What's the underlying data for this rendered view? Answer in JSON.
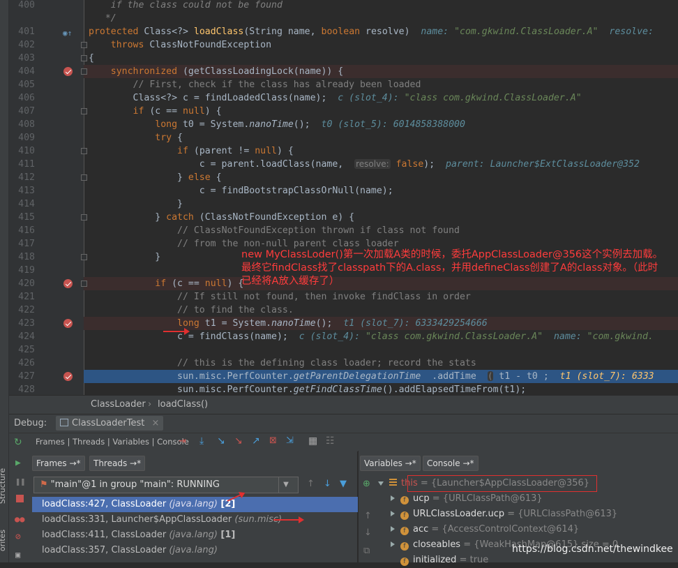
{
  "editor": {
    "lines": [
      {
        "n": "400",
        "html": "<span class='cm it'>    if the class could not be found</span>"
      },
      {
        "n": "",
        "html": "<span class='cm it'>   */</span>"
      },
      {
        "n": "401",
        "html": "<span class='kw'>protected</span> Class&lt;?&gt; <span class='fn'>loadClass</span>(String name, <span class='kw'>boolean</span> resolve)  <span class='hint'>name: <span class='hintv'>\"com.gkwind.ClassLoader.A\"</span>  resolve:</span>"
      },
      {
        "n": "402",
        "html": "    <span class='kw'>throws</span> ClassNotFoundException"
      },
      {
        "n": "403",
        "html": "{"
      },
      {
        "n": "404",
        "html": "    <span class='kw'>synchronized</span> (getClassLoadingLock(name)) {"
      },
      {
        "n": "405",
        "html": "        <span class='cm'>// First, check if the class has already been loaded</span>"
      },
      {
        "n": "406",
        "html": "        Class&lt;?&gt; c = findLoadedClass(name);  <span class='hint'>c (slot_4): <span class='hintv'>\"class com.gkwind.ClassLoader.A\"</span></span>"
      },
      {
        "n": "407",
        "html": "        <span class='kw'>if</span> (c == <span class='kw'>null</span>) {"
      },
      {
        "n": "408",
        "html": "            <span class='kw'>long</span> t0 = System.<span class='it'>nanoTime</span>();  <span class='hint'>t0 (slot_5): 6014858388000</span>"
      },
      {
        "n": "409",
        "html": "            <span class='kw'>try</span> {"
      },
      {
        "n": "410",
        "html": "                <span class='kw'>if</span> (parent != <span class='kw'>null</span>) {"
      },
      {
        "n": "411",
        "html": "                    c = parent.loadClass(name,  <span class='pn'>resolve:</span> <span class='kw'>false</span>);  <span class='hint'>parent: Launcher$ExtClassLoader@352</span>"
      },
      {
        "n": "412",
        "html": "                } <span class='kw'>else</span> {"
      },
      {
        "n": "413",
        "html": "                    c = findBootstrapClassOrNull(name);"
      },
      {
        "n": "414",
        "html": "                }"
      },
      {
        "n": "415",
        "html": "            } <span class='kw'>catch</span> (ClassNotFoundException e) {"
      },
      {
        "n": "416",
        "html": "                <span class='cm'>// ClassNotFoundException thrown if class not found</span>"
      },
      {
        "n": "417",
        "html": "                <span class='cm'>// from the non-null parent class loader</span>"
      },
      {
        "n": "418",
        "html": "            }"
      },
      {
        "n": "419",
        "html": ""
      },
      {
        "n": "420",
        "html": "            <span class='kw'>if</span> (c == <span class='kw'>null</span>) {"
      },
      {
        "n": "421",
        "html": "                <span class='cm'>// If still not found, then invoke findClass in order</span>"
      },
      {
        "n": "422",
        "html": "                <span class='cm'>// to find the class.</span>"
      },
      {
        "n": "423",
        "html": "                <span class='kw'>long</span> t1 = System.<span class='it'>nanoTime</span>();  <span class='hint'>t1 (slot_7): 6333429254666</span>"
      },
      {
        "n": "424",
        "html": "                c = findClass(name);  <span class='hint'>c (slot_4): <span class='hintv'>\"class com.gkwind.ClassLoader.A\"</span>  name: <span class='hintv'>\"com.gkwind.</span></span>"
      },
      {
        "n": "425",
        "html": ""
      },
      {
        "n": "426",
        "html": "                <span class='cm'>// this is the defining class loader; record the stats</span>"
      },
      {
        "n": "427",
        "html": "                sun.misc.PerfCounter.<span class='it'>getParentDelegationTime</span>  .addTime  <span class='pn'>(</span> t1 - t0 ;  <span class='it' style='color:#ffc66d'>t1 (slot_7): 6333</span>"
      },
      {
        "n": "428",
        "html": "                sun.misc.PerfCounter.<span class='it'>getFindClassTime</span>().addElapsedTimeFrom(t1);"
      }
    ],
    "note": "new MyClassLoder()第一次加载A类的时候，委托AppClassLoader@356这个实例去加载。最终它findClass找了classpath下的A.class，并用defineClass创建了A的class对象。（此时已经将A放入缓存了）"
  },
  "breadcrumb": {
    "class": "ClassLoader",
    "method": "loadClass()"
  },
  "debug": {
    "label": "Debug:",
    "config": "ClassLoaderTest",
    "toolbar_tabs": "Frames | Threads | Variables | Console"
  },
  "frames_panel": {
    "tab_frames": "Frames →*",
    "tab_threads": "Threads →*",
    "thread": "\"main\"@1 in group \"main\": RUNNING",
    "frames": [
      {
        "method": "loadClass:427, ClassLoader ",
        "pkg": "(java.lang)",
        "badge": "[2]"
      },
      {
        "method": "loadClass:331, Launcher$AppClassLoader ",
        "pkg": "(sun.misc)",
        "badge": ""
      },
      {
        "method": "loadClass:411, ClassLoader ",
        "pkg": "(java.lang)",
        "badge": "[1]"
      },
      {
        "method": "loadClass:357, ClassLoader ",
        "pkg": "(java.lang)",
        "badge": ""
      }
    ]
  },
  "vars_panel": {
    "tab_vars": "Variables →*",
    "tab_console": "Console →*",
    "vars": [
      {
        "name": "this",
        "val": " = {Launcher$AppClassLoader@356}"
      },
      {
        "name": "ucp",
        "val": " = {URLClassPath@613}"
      },
      {
        "name": "URLClassLoader.ucp",
        "val": " = {URLClassPath@613}"
      },
      {
        "name": "acc",
        "val": " = {AccessControlContext@614}"
      },
      {
        "name": "closeables",
        "val": " = {WeakHashMap@615}  size = 0"
      },
      {
        "name": "initialized",
        "val": " = true"
      }
    ],
    "watermark": "https://blog.csdn.net/thewindkee"
  },
  "side_labels": {
    "structure": "Structure",
    "favorites": "orites"
  }
}
